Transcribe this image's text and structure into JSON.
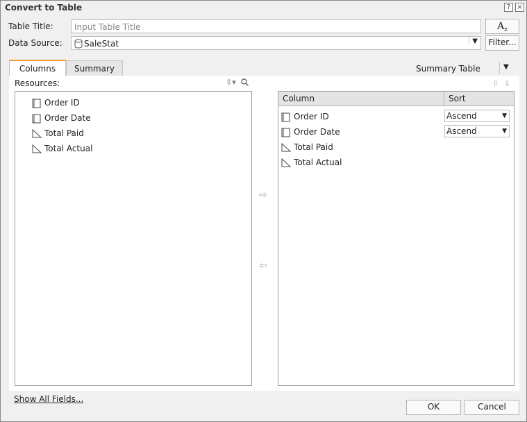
{
  "window": {
    "title": "Convert to Table",
    "help": "?",
    "close": "×"
  },
  "form": {
    "table_title_label": "Table Title:",
    "table_title_placeholder": "Input Table Title",
    "format_button": "A",
    "data_source_label": "Data Source:",
    "data_source_value": "SaleStat",
    "filter_button": "Filter..."
  },
  "tabs": [
    {
      "label": "Columns",
      "active": true
    },
    {
      "label": "Summary",
      "active": false
    }
  ],
  "view_select": "Summary Table",
  "resources": {
    "label": "Resources:",
    "items": [
      {
        "label": "Order ID",
        "icon": "category-icon"
      },
      {
        "label": "Order Date",
        "icon": "category-icon"
      },
      {
        "label": "Total Paid",
        "icon": "measure-icon"
      },
      {
        "label": "Total Actual",
        "icon": "measure-icon"
      }
    ]
  },
  "columns_table": {
    "headers": {
      "column": "Column",
      "sort": "Sort"
    },
    "rows": [
      {
        "label": "Order ID",
        "icon": "category-icon",
        "sort": "Ascend"
      },
      {
        "label": "Order Date",
        "icon": "category-icon",
        "sort": "Ascend"
      },
      {
        "label": "Total Paid",
        "icon": "measure-icon",
        "sort": ""
      },
      {
        "label": "Total Actual",
        "icon": "measure-icon",
        "sort": ""
      }
    ]
  },
  "footer": {
    "show_all_fields": "Show All Fields...",
    "ok": "OK",
    "cancel": "Cancel"
  },
  "colors": {
    "tab_accent": "#f09a2a",
    "panel_border": "#9d9d9d",
    "dialog_bg": "#f0f0f0"
  }
}
